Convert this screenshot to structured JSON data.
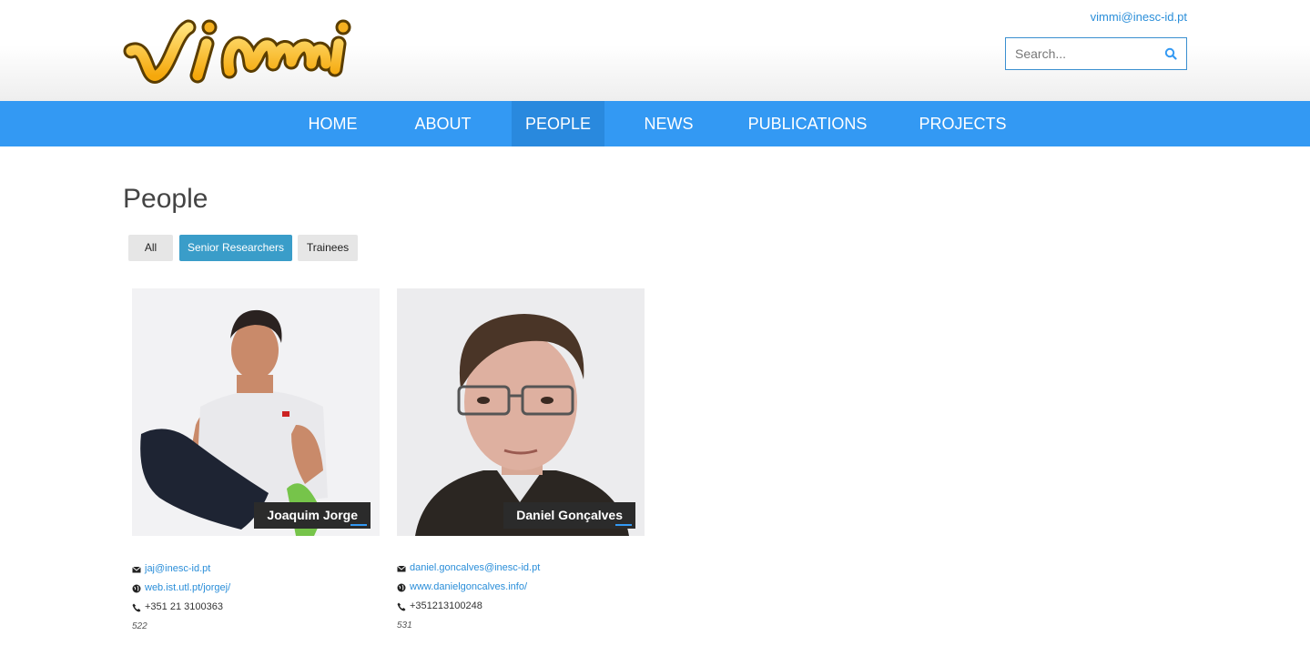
{
  "header": {
    "logo_text": "vimmi",
    "contact_email": "vimmi@inesc-id.pt",
    "search_placeholder": "Search..."
  },
  "nav": {
    "items": [
      {
        "label": "HOME"
      },
      {
        "label": "ABOUT"
      },
      {
        "label": "PEOPLE"
      },
      {
        "label": "NEWS"
      },
      {
        "label": "PUBLICATIONS"
      },
      {
        "label": "PROJECTS"
      }
    ],
    "active": "PEOPLE",
    "color": "#3399f3"
  },
  "page": {
    "title": "People"
  },
  "filters": [
    {
      "label": "All"
    },
    {
      "label": "Senior Researchers"
    },
    {
      "label": "Trainees"
    }
  ],
  "active_filter": "Senior Researchers",
  "people": [
    {
      "name": "Joaquim Jorge",
      "email": "jaj@inesc-id.pt",
      "website": "web.ist.utl.pt/jorgej/",
      "phone": "+351 21 3100363",
      "room": "522"
    },
    {
      "name": "Daniel Gonçalves",
      "email": "daniel.goncalves@inesc-id.pt",
      "website": "www.danielgoncalves.info/",
      "phone": "+351213100248",
      "room": "531"
    }
  ],
  "icons": {
    "email": "envelope-icon",
    "website": "globe-icon",
    "phone": "phone-icon",
    "search": "search-icon"
  }
}
